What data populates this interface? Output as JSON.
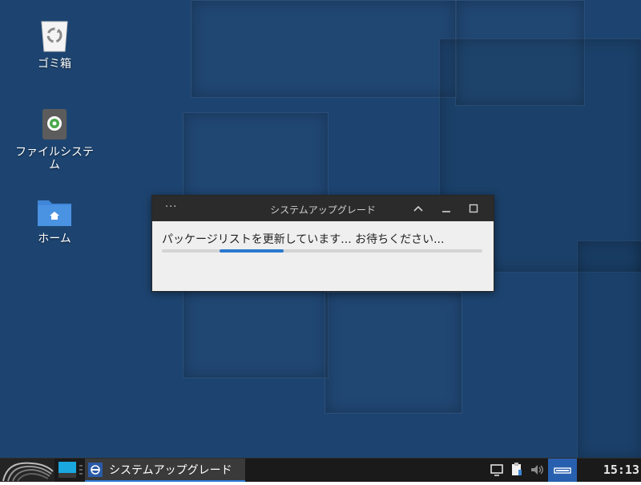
{
  "desktop": {
    "icons": [
      {
        "label": "ゴミ箱",
        "icon": "trash-icon"
      },
      {
        "label": "ファイルシステム",
        "icon": "drive-icon"
      },
      {
        "label": "ホーム",
        "icon": "home-folder-icon"
      }
    ]
  },
  "dialog": {
    "title": "システムアップグレード",
    "message": "パッケージリストを更新しています... お待ちください...",
    "progress": {
      "start_fraction": 0.18,
      "end_fraction": 0.38,
      "indeterminate": true
    },
    "buttons": {
      "menu": "···",
      "collapse": "collapse-icon",
      "minimize": "minimize-icon",
      "maximize": "maximize-icon"
    }
  },
  "taskbar": {
    "task_label": "システムアップグレード",
    "clock": "15:13",
    "colors": {
      "accent": "#2f7bd6",
      "tray_active": "#2860b0"
    }
  }
}
